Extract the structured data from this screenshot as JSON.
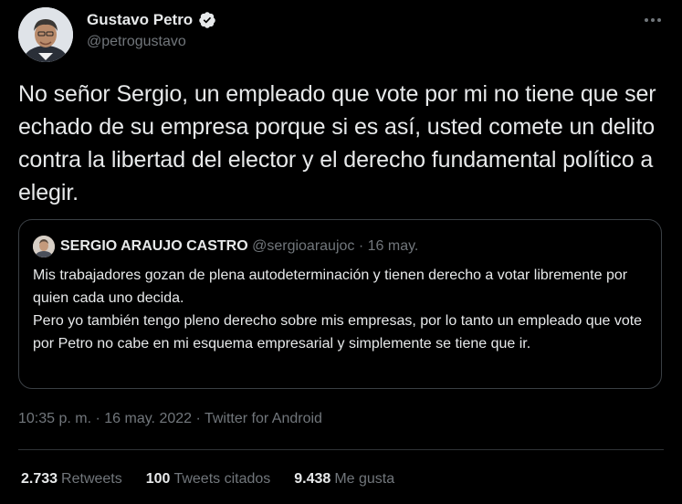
{
  "author": {
    "name": "Gustavo Petro",
    "handle": "@petrogustavo"
  },
  "tweet": {
    "text": "No señor Sergio, un empleado que vote por mi no tiene que ser echado de su empresa porque si es así, usted comete un delito contra la libertad del elector y el derecho fundamental político a elegir."
  },
  "quoted": {
    "name": "SERGIO ARAUJO CASTRO",
    "handle": "@sergioaraujoc",
    "separator": " · ",
    "date": "16 may.",
    "lines": [
      "Mis trabajadores gozan de plena autodeterminación y tienen derecho a votar libremente por quien cada uno decida.",
      "Pero yo también tengo pleno derecho sobre mis empresas, por lo tanto un empleado que vote por Petro no cabe en mi esquema empresarial y simplemente se tiene que ir."
    ]
  },
  "meta": {
    "time": "10:35 p. m.",
    "separator": " · ",
    "date": "16 may. 2022",
    "source": "Twitter for Android"
  },
  "stats": {
    "retweets_value": "2.733",
    "retweets_label": "Retweets",
    "quotes_value": "100",
    "quotes_label": "Tweets citados",
    "likes_value": "9.438",
    "likes_label": "Me gusta"
  },
  "icons": {
    "verified": "verified-badge-icon",
    "more": "more-options-icon"
  },
  "colors": {
    "background": "#000000",
    "text_primary": "#e7e9ea",
    "text_secondary": "#71767b",
    "border": "#2f3336"
  }
}
